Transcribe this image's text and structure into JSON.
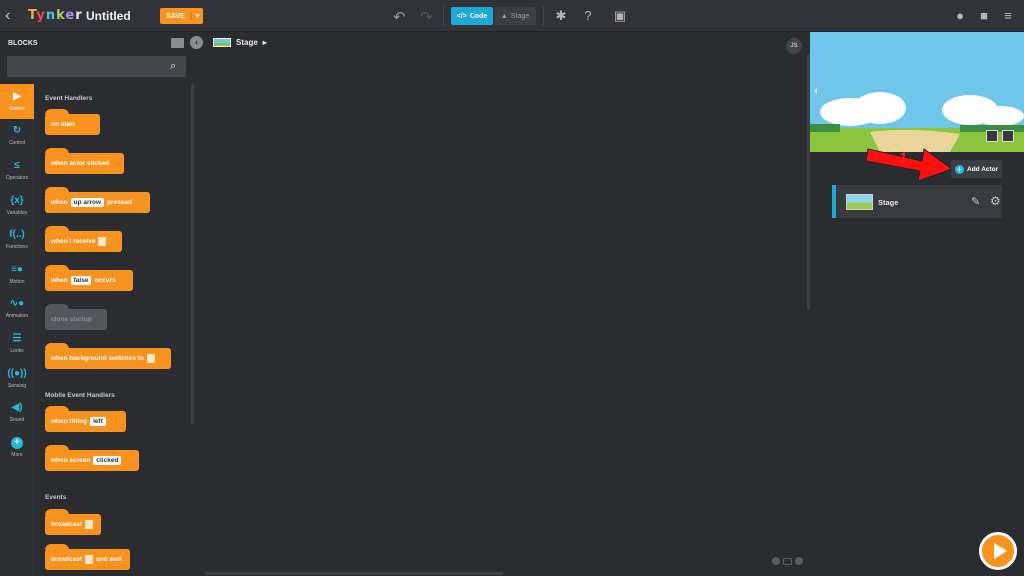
{
  "app": {
    "title": "Untitled",
    "save_label": "SAVE",
    "tabs": [
      {
        "label": "Code",
        "active": true
      },
      {
        "label": "Stage",
        "active": false
      }
    ]
  },
  "blocks_panel": {
    "title": "BLOCKS",
    "search_placeholder": ""
  },
  "categories": [
    {
      "label": "Events",
      "icon": "play-icon",
      "active": true
    },
    {
      "label": "Control",
      "icon": "loop-icon"
    },
    {
      "label": "Operators",
      "icon": "operators-icon"
    },
    {
      "label": "Variables",
      "icon": "variables-icon"
    },
    {
      "label": "Functions",
      "icon": "functions-icon"
    },
    {
      "label": "Motion",
      "icon": "motion-icon"
    },
    {
      "label": "Animation",
      "icon": "animation-icon"
    },
    {
      "label": "Looks",
      "icon": "looks-icon"
    },
    {
      "label": "Sensing",
      "icon": "sensing-icon"
    },
    {
      "label": "Sound",
      "icon": "sound-icon"
    },
    {
      "label": "More",
      "icon": "plus-circle-icon"
    }
  ],
  "sections": {
    "event_handlers": "Event Handlers",
    "mobile_event_handlers": "Mobile Event Handlers",
    "events": "Events"
  },
  "blocks": {
    "on_start": "on start",
    "when_actor_clicked": "when actor clicked",
    "when_key_pre": "when",
    "when_key_slot": "up arrow",
    "when_key_post": "pressed",
    "when_i_receive": "when I receive",
    "when_occurs_pre": "when",
    "when_occurs_slot": "false",
    "when_occurs_post": "occurs",
    "clone_startup": "clone startup",
    "when_bg_switches": "when background switches to",
    "when_tilting": "when tilting",
    "when_tilting_slot": "left",
    "when_screen": "when screen",
    "when_screen_slot": "clicked",
    "broadcast": "broadcast",
    "broadcast_wait_pre": "broadcast",
    "broadcast_wait_post": "and wait"
  },
  "canvas": {
    "breadcrumb": "Stage",
    "js_badge": "JS"
  },
  "right_panel": {
    "add_actor_label": "Add Actor",
    "annotation_number": "1",
    "actors": [
      {
        "name": "Stage"
      }
    ]
  },
  "colors": {
    "accent": "#f7931e",
    "primary": "#1fa9d6",
    "background": "#2b2c30",
    "annotation": "#ff2020"
  }
}
